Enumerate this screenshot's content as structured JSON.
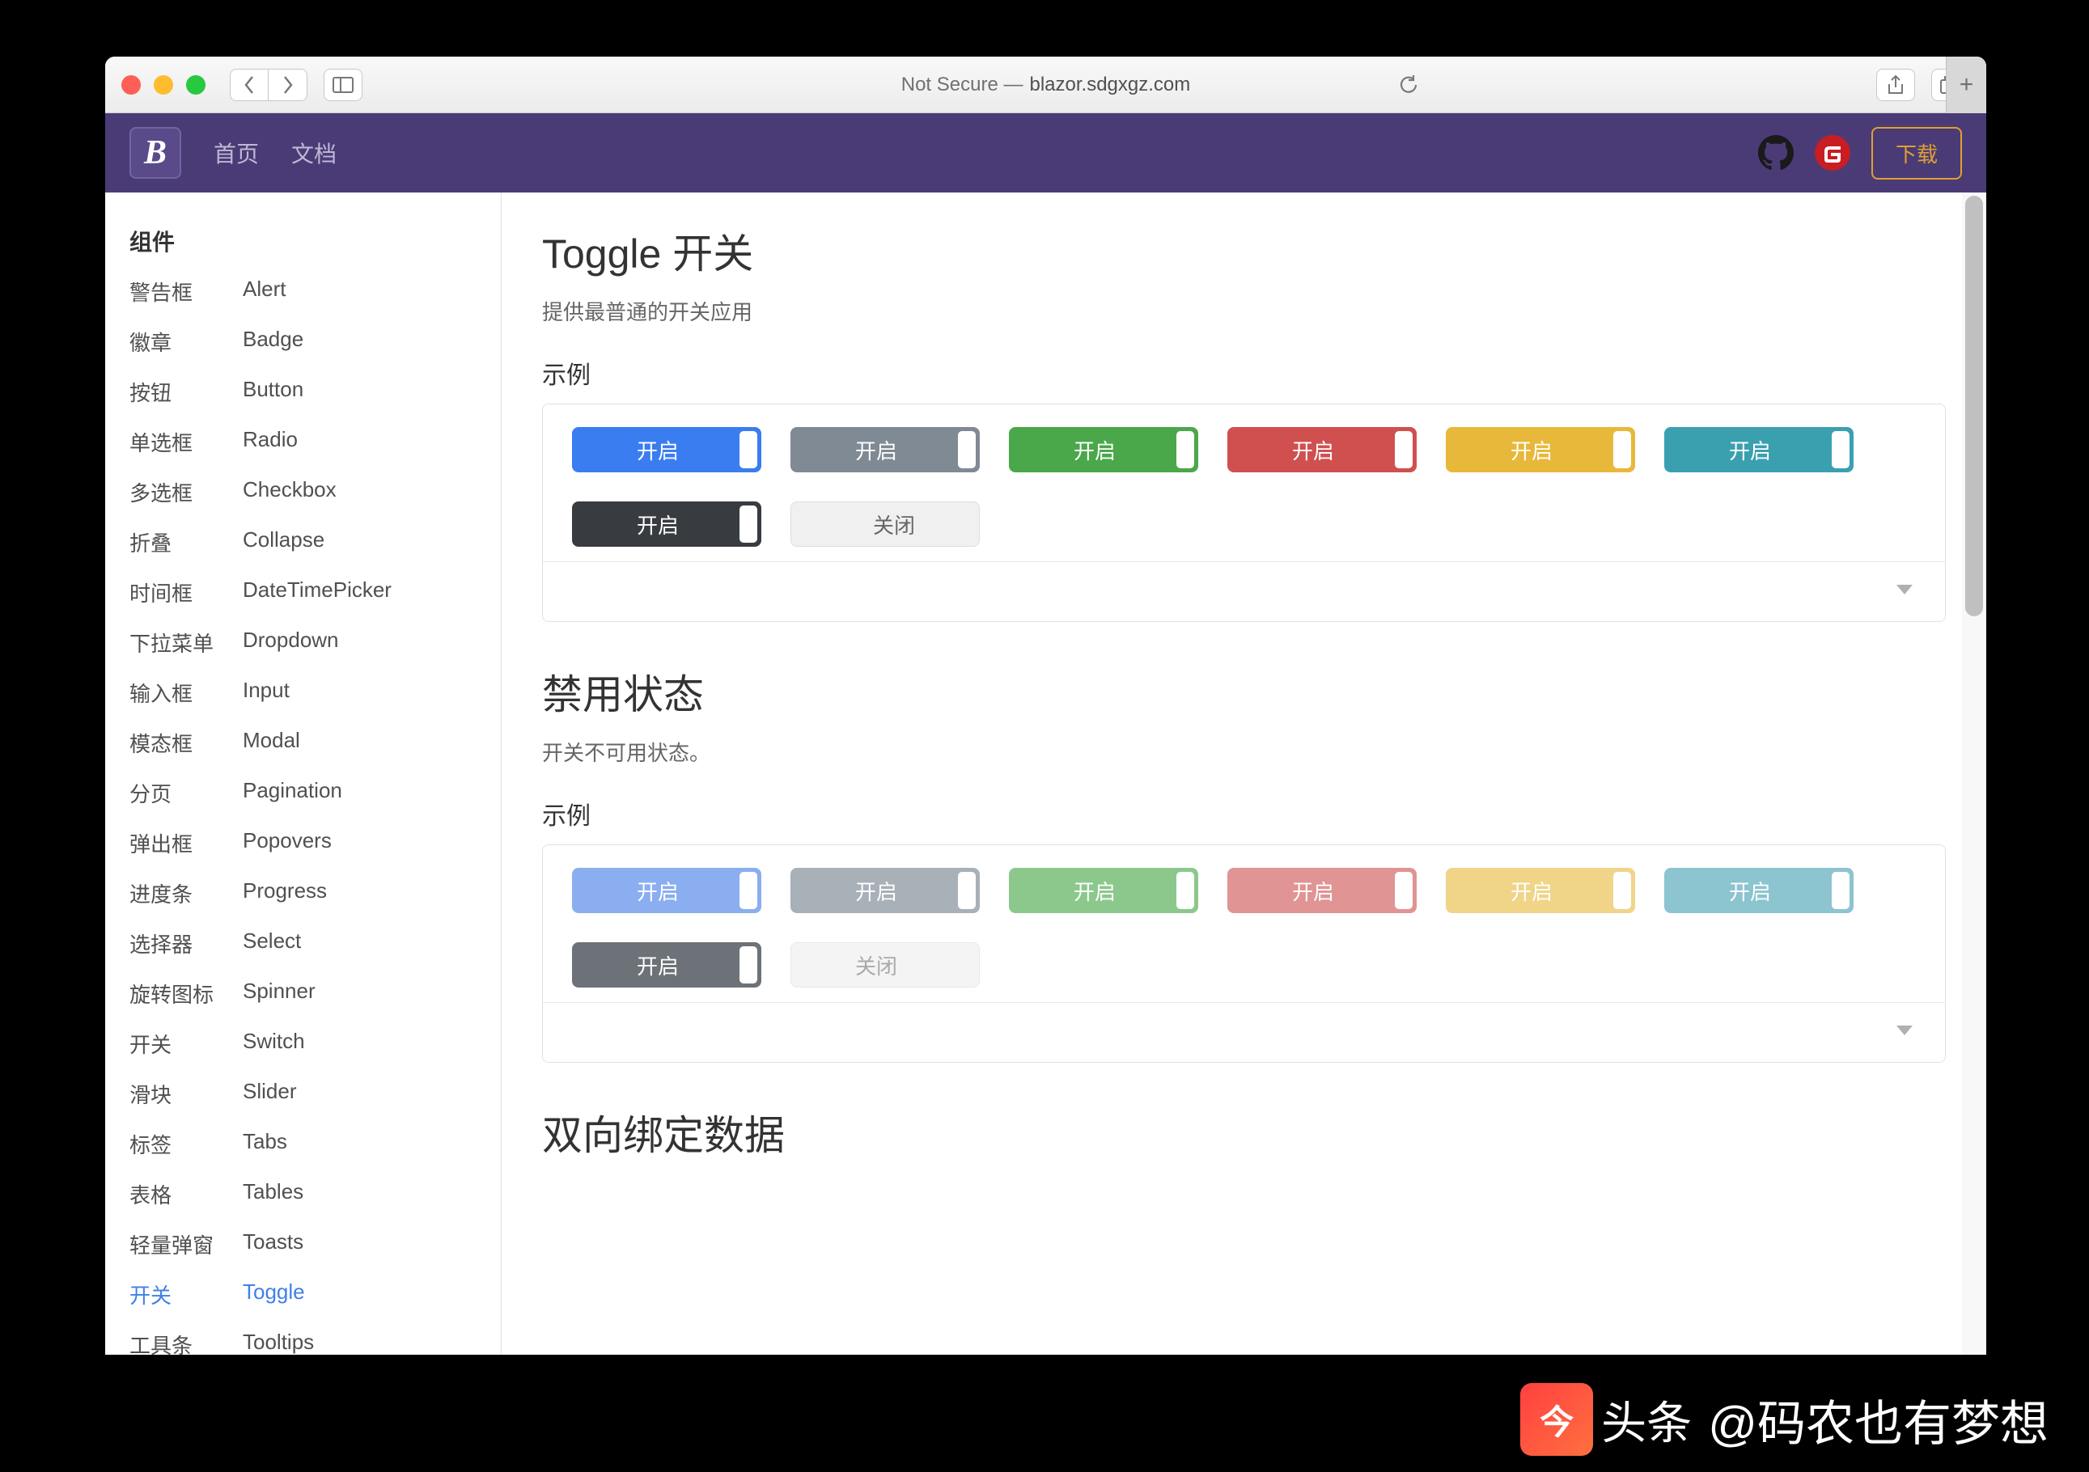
{
  "browser": {
    "url_prefix": "Not Secure —",
    "url": "blazor.sdgxgz.com"
  },
  "header": {
    "logo": "B",
    "nav": [
      "首页",
      "文档"
    ],
    "download": "下载"
  },
  "sidebar": {
    "heading": "组件",
    "items": [
      {
        "zh": "警告框",
        "en": "Alert"
      },
      {
        "zh": "徽章",
        "en": "Badge"
      },
      {
        "zh": "按钮",
        "en": "Button"
      },
      {
        "zh": "单选框",
        "en": "Radio"
      },
      {
        "zh": "多选框",
        "en": "Checkbox"
      },
      {
        "zh": "折叠",
        "en": "Collapse"
      },
      {
        "zh": "时间框",
        "en": "DateTimePicker"
      },
      {
        "zh": "下拉菜单",
        "en": "Dropdown"
      },
      {
        "zh": "输入框",
        "en": "Input"
      },
      {
        "zh": "模态框",
        "en": "Modal"
      },
      {
        "zh": "分页",
        "en": "Pagination"
      },
      {
        "zh": "弹出框",
        "en": "Popovers"
      },
      {
        "zh": "进度条",
        "en": "Progress"
      },
      {
        "zh": "选择器",
        "en": "Select"
      },
      {
        "zh": "旋转图标",
        "en": "Spinner"
      },
      {
        "zh": "开关",
        "en": "Switch"
      },
      {
        "zh": "滑块",
        "en": "Slider"
      },
      {
        "zh": "标签",
        "en": "Tabs"
      },
      {
        "zh": "表格",
        "en": "Tables"
      },
      {
        "zh": "轻量弹窗",
        "en": "Toasts"
      },
      {
        "zh": "开关",
        "en": "Toggle",
        "active": true
      },
      {
        "zh": "工具条",
        "en": "Tooltips"
      }
    ]
  },
  "main": {
    "section1": {
      "title": "Toggle 开关",
      "subtitle": "提供最普通的开关应用",
      "example_label": "示例",
      "on": "开启",
      "off": "关闭"
    },
    "section2": {
      "title": "禁用状态",
      "subtitle": "开关不可用状态。",
      "example_label": "示例",
      "on": "开启",
      "off": "关闭"
    },
    "section3": {
      "title": "双向绑定数据"
    }
  },
  "watermark": {
    "brand": "头条",
    "author": "@码农也有梦想"
  }
}
